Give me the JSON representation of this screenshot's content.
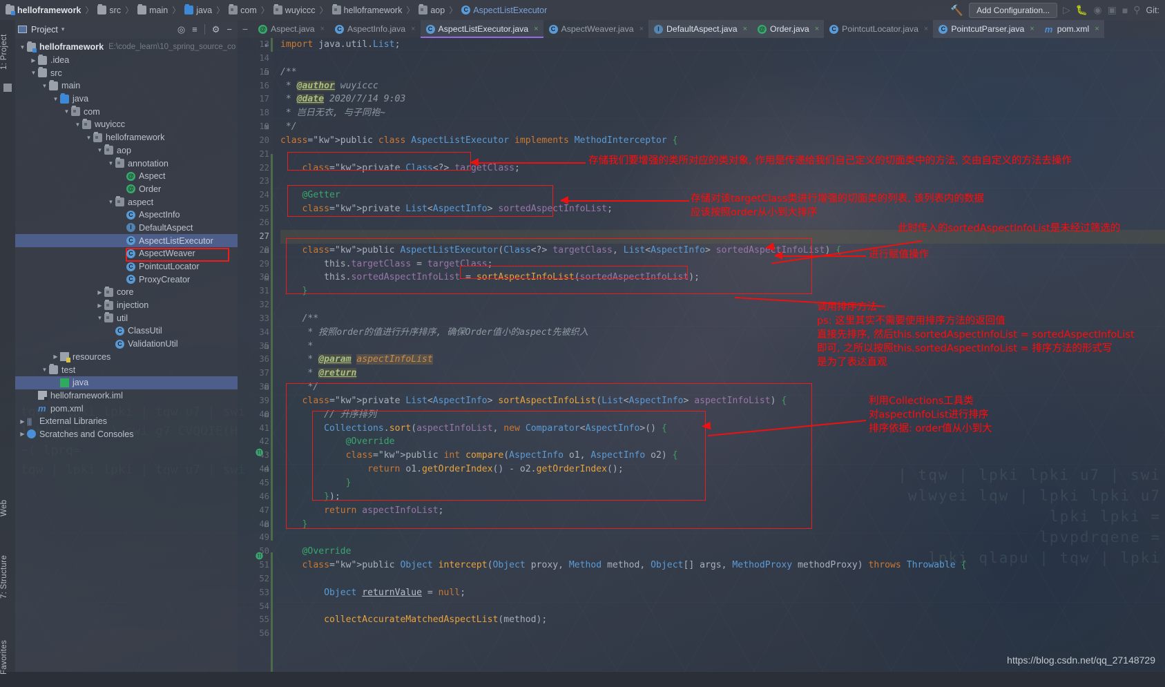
{
  "window": {
    "breadcrumbs": [
      {
        "label": "helloframework",
        "icon": "module-icon"
      },
      {
        "label": "src",
        "icon": "folder-icon"
      },
      {
        "label": "main",
        "icon": "folder-icon"
      },
      {
        "label": "java",
        "icon": "folder-blue-icon"
      },
      {
        "label": "com",
        "icon": "package-icon"
      },
      {
        "label": "wuyiccc",
        "icon": "package-icon"
      },
      {
        "label": "helloframework",
        "icon": "package-icon"
      },
      {
        "label": "aop",
        "icon": "package-icon"
      },
      {
        "label": "AspectListExecutor",
        "icon": "class-icon"
      }
    ],
    "separator": "〉",
    "add_configuration": "Add Configuration...",
    "git_label": "Git:",
    "hammer_icon": "build-hammer-icon"
  },
  "left_strips": [
    {
      "label": "1: Project"
    },
    {
      "label": "Web"
    },
    {
      "label": "7: Structure"
    },
    {
      "label": "Favorites"
    }
  ],
  "project_panel": {
    "title": "Project",
    "caret": "▾",
    "actions": [
      "locate-icon",
      "collapse-all-icon",
      "gear-icon",
      "hide-icon"
    ],
    "tree": [
      {
        "indent": 0,
        "arrow": "▼",
        "icon": "module-icon",
        "label": "helloframework",
        "bold": true,
        "path": "E:\\code_learn\\10_spring_source_co",
        "selected": false
      },
      {
        "indent": 1,
        "arrow": "▶",
        "icon": "folder-icon",
        "label": ".idea",
        "bold": false,
        "path": "",
        "selected": false
      },
      {
        "indent": 1,
        "arrow": "▼",
        "icon": "folder-icon",
        "label": "src",
        "bold": false,
        "path": "",
        "selected": false
      },
      {
        "indent": 2,
        "arrow": "▼",
        "icon": "folder-icon",
        "label": "main",
        "bold": false,
        "path": "",
        "selected": false
      },
      {
        "indent": 3,
        "arrow": "▼",
        "icon": "folder-blue-icon",
        "label": "java",
        "bold": false,
        "path": "",
        "selected": false
      },
      {
        "indent": 4,
        "arrow": "▼",
        "icon": "package-icon",
        "label": "com",
        "bold": false,
        "path": "",
        "selected": false
      },
      {
        "indent": 5,
        "arrow": "▼",
        "icon": "package-icon",
        "label": "wuyiccc",
        "bold": false,
        "path": "",
        "selected": false
      },
      {
        "indent": 6,
        "arrow": "▼",
        "icon": "package-icon",
        "label": "helloframework",
        "bold": false,
        "path": "",
        "selected": false
      },
      {
        "indent": 7,
        "arrow": "▼",
        "icon": "package-icon",
        "label": "aop",
        "bold": false,
        "path": "",
        "selected": false
      },
      {
        "indent": 8,
        "arrow": "▼",
        "icon": "package-icon",
        "label": "annotation",
        "bold": false,
        "path": "",
        "selected": false
      },
      {
        "indent": 9,
        "arrow": "",
        "icon": "annotation-icon",
        "label": "Aspect",
        "bold": false,
        "path": "",
        "selected": false
      },
      {
        "indent": 9,
        "arrow": "",
        "icon": "annotation-icon",
        "label": "Order",
        "bold": false,
        "path": "",
        "selected": false
      },
      {
        "indent": 8,
        "arrow": "▼",
        "icon": "package-icon",
        "label": "aspect",
        "bold": false,
        "path": "",
        "selected": false
      },
      {
        "indent": 9,
        "arrow": "",
        "icon": "class-icon",
        "label": "AspectInfo",
        "bold": false,
        "path": "",
        "selected": false
      },
      {
        "indent": 9,
        "arrow": "",
        "icon": "interface-icon",
        "label": "DefaultAspect",
        "bold": false,
        "path": "",
        "selected": false
      },
      {
        "indent": 9,
        "arrow": "",
        "icon": "class-icon",
        "label": "AspectListExecutor",
        "bold": false,
        "path": "",
        "selected": true
      },
      {
        "indent": 9,
        "arrow": "",
        "icon": "class-icon",
        "label": "AspectWeaver",
        "bold": false,
        "path": "",
        "selected": false
      },
      {
        "indent": 9,
        "arrow": "",
        "icon": "class-icon",
        "label": "PointcutLocator",
        "bold": false,
        "path": "",
        "selected": false
      },
      {
        "indent": 9,
        "arrow": "",
        "icon": "class-icon",
        "label": "ProxyCreator",
        "bold": false,
        "path": "",
        "selected": false
      },
      {
        "indent": 7,
        "arrow": "▶",
        "icon": "package-icon",
        "label": "core",
        "bold": false,
        "path": "",
        "selected": false
      },
      {
        "indent": 7,
        "arrow": "▶",
        "icon": "package-icon",
        "label": "injection",
        "bold": false,
        "path": "",
        "selected": false
      },
      {
        "indent": 7,
        "arrow": "▼",
        "icon": "package-icon",
        "label": "util",
        "bold": false,
        "path": "",
        "selected": false
      },
      {
        "indent": 8,
        "arrow": "",
        "icon": "class-icon",
        "label": "ClassUtil",
        "bold": false,
        "path": "",
        "selected": false
      },
      {
        "indent": 8,
        "arrow": "",
        "icon": "class-icon",
        "label": "ValidationUtil",
        "bold": false,
        "path": "",
        "selected": false
      },
      {
        "indent": 3,
        "arrow": "▶",
        "icon": "resources-icon",
        "label": "resources",
        "bold": false,
        "path": "",
        "selected": false
      },
      {
        "indent": 2,
        "arrow": "▼",
        "icon": "folder-icon",
        "label": "test",
        "bold": false,
        "path": "",
        "selected": false
      },
      {
        "indent": 3,
        "arrow": "",
        "icon": "test-source-icon",
        "label": "java",
        "bold": false,
        "path": "",
        "selected": true
      },
      {
        "indent": 1,
        "arrow": "",
        "icon": "iml-icon",
        "label": "helloframework.iml",
        "bold": false,
        "path": "",
        "selected": false
      },
      {
        "indent": 1,
        "arrow": "",
        "icon": "maven-icon",
        "label": "pom.xml",
        "bold": false,
        "path": "",
        "selected": false
      },
      {
        "indent": 0,
        "arrow": "▶",
        "icon": "libraries-icon",
        "label": "External Libraries",
        "bold": false,
        "path": "",
        "selected": false
      },
      {
        "indent": 0,
        "arrow": "▶",
        "icon": "scratches-icon",
        "label": "Scratches and Consoles",
        "bold": false,
        "path": "",
        "selected": false
      }
    ],
    "highlight_color": "#ee1c1c",
    "selected_row_color": "#53679c"
  },
  "editor_tabs": [
    {
      "label": "Aspect.java",
      "icon": "annotation-icon",
      "state": "inactive",
      "close": "×"
    },
    {
      "label": "AspectInfo.java",
      "icon": "class-icon",
      "state": "inactive",
      "close": "×"
    },
    {
      "label": "AspectListExecutor.java",
      "icon": "class-icon",
      "state": "current",
      "close": "×"
    },
    {
      "label": "AspectWeaver.java",
      "icon": "class-icon",
      "state": "inactive",
      "close": "×"
    },
    {
      "label": "DefaultAspect.java",
      "icon": "interface-icon",
      "state": "active",
      "close": "×"
    },
    {
      "label": "Order.java",
      "icon": "annotation-icon",
      "state": "active",
      "close": "×"
    },
    {
      "label": "PointcutLocator.java",
      "icon": "class-icon",
      "state": "inactive",
      "close": "×"
    },
    {
      "label": "PointcutParser.java",
      "icon": "class-icon",
      "state": "active",
      "close": "×"
    },
    {
      "label": "pom.xml",
      "icon": "maven-icon",
      "state": "active",
      "close": "×"
    }
  ],
  "editor": {
    "accent_underline": "#9b6ae0",
    "first_line_number": 13,
    "current_line": 27,
    "lines": [
      {
        "n": 13,
        "text": "import java.util.List;"
      },
      {
        "n": 14,
        "text": ""
      },
      {
        "n": 15,
        "text": "/**"
      },
      {
        "n": 16,
        "text": " * @author wuyiccc"
      },
      {
        "n": 17,
        "text": " * @date 2020/7/14 9:03"
      },
      {
        "n": 18,
        "text": " * 岂日无衣, 与子同袍~"
      },
      {
        "n": 19,
        "text": " */"
      },
      {
        "n": 20,
        "text": "public class AspectListExecutor implements MethodInterceptor {"
      },
      {
        "n": 21,
        "text": ""
      },
      {
        "n": 22,
        "text": "    private Class<?> targetClass;"
      },
      {
        "n": 23,
        "text": ""
      },
      {
        "n": 24,
        "text": "    @Getter"
      },
      {
        "n": 25,
        "text": "    private List<AspectInfo> sortedAspectInfoList;"
      },
      {
        "n": 26,
        "text": ""
      },
      {
        "n": 27,
        "text": ""
      },
      {
        "n": 28,
        "text": "    public AspectListExecutor(Class<?> targetClass, List<AspectInfo> sortedAspectInfoList) {"
      },
      {
        "n": 29,
        "text": "        this.targetClass = targetClass;"
      },
      {
        "n": 30,
        "text": "        this.sortedAspectInfoList = sortAspectInfoList(sortedAspectInfoList);"
      },
      {
        "n": 31,
        "text": "    }"
      },
      {
        "n": 32,
        "text": ""
      },
      {
        "n": 33,
        "text": "    /**"
      },
      {
        "n": 34,
        "text": "     * 按照order的值进行升序排序, 确保Order值小的aspect先被织入"
      },
      {
        "n": 35,
        "text": "     *"
      },
      {
        "n": 36,
        "text": "     * @param aspectInfoList"
      },
      {
        "n": 37,
        "text": "     * @return"
      },
      {
        "n": 38,
        "text": "     */"
      },
      {
        "n": 39,
        "text": "    private List<AspectInfo> sortAspectInfoList(List<AspectInfo> aspectInfoList) {"
      },
      {
        "n": 40,
        "text": "        // 升序排列"
      },
      {
        "n": 41,
        "text": "        Collections.sort(aspectInfoList, new Comparator<AspectInfo>() {"
      },
      {
        "n": 42,
        "text": "            @Override"
      },
      {
        "n": 43,
        "text": "            public int compare(AspectInfo o1, AspectInfo o2) {"
      },
      {
        "n": 44,
        "text": "                return o1.getOrderIndex() - o2.getOrderIndex();"
      },
      {
        "n": 45,
        "text": "            }"
      },
      {
        "n": 46,
        "text": "        });"
      },
      {
        "n": 47,
        "text": "        return aspectInfoList;"
      },
      {
        "n": 48,
        "text": "    }"
      },
      {
        "n": 49,
        "text": ""
      },
      {
        "n": 50,
        "text": "    @Override"
      },
      {
        "n": 51,
        "text": "    public Object intercept(Object proxy, Method method, Object[] args, MethodProxy methodProxy) throws Throwable {"
      },
      {
        "n": 52,
        "text": ""
      },
      {
        "n": 53,
        "text": "        Object returnValue = null;"
      },
      {
        "n": 54,
        "text": ""
      },
      {
        "n": 55,
        "text": "        collectAccurateMatchedAspectList(method);"
      },
      {
        "n": 56,
        "text": ""
      }
    ]
  },
  "annotations": {
    "color": "#ef1111",
    "items": [
      {
        "id": "note-target-class",
        "text": "存储我们要增强的类所对应的类对象, 作用是传递给我们自己定义的切面类中的方法, 交由自定义的方法去操作"
      },
      {
        "id": "note-sorted-list-1",
        "text": "存储对该targetClass类进行增强的切面类的列表, 该列表内的数据"
      },
      {
        "id": "note-sorted-list-2",
        "text": "应该按照order从小到大排序"
      },
      {
        "id": "note-unfiltered",
        "text": "此时传入的sortedAspectInfoList是未经过筛选的"
      },
      {
        "id": "note-assign",
        "text": "进行赋值操作"
      },
      {
        "id": "note-call-sort-1",
        "text": "调用排序方法"
      },
      {
        "id": "note-call-sort-2",
        "text": "ps: 这里其实不需要使用排序方法的返回值"
      },
      {
        "id": "note-call-sort-3",
        "text": "直接先排序, 然后this.sortedAspectInfoList = sortedAspectInfoList"
      },
      {
        "id": "note-call-sort-4",
        "text": "即可, 之所以按照this.sortedAspectInfoList = 排序方法的形式写"
      },
      {
        "id": "note-call-sort-5",
        "text": "是为了表达直观"
      },
      {
        "id": "note-collections-1",
        "text": "利用Collections工具类"
      },
      {
        "id": "note-collections-2",
        "text": "对aspectInfoList进行排序"
      },
      {
        "id": "note-collections-3",
        "text": "排序依据: order值从小到大"
      }
    ]
  },
  "watermark": "https://blog.csdn.net/qq_27148729",
  "texture": {
    "block1": "| tqw | lpki lpki u7 | swi\nwlwyei lqw | lpki lpki u7\nlpki lpki =\nlpvpdrqene =\nlpki qlapu | tqw | lpki",
    "block2": "tqw | lpki lpki | tqw u7 | swi\nlpki lpki = ) swi g7 CVQOIE(H\n~( lprq=\ntqw | lpki lpki | tqw u7 | swi"
  }
}
